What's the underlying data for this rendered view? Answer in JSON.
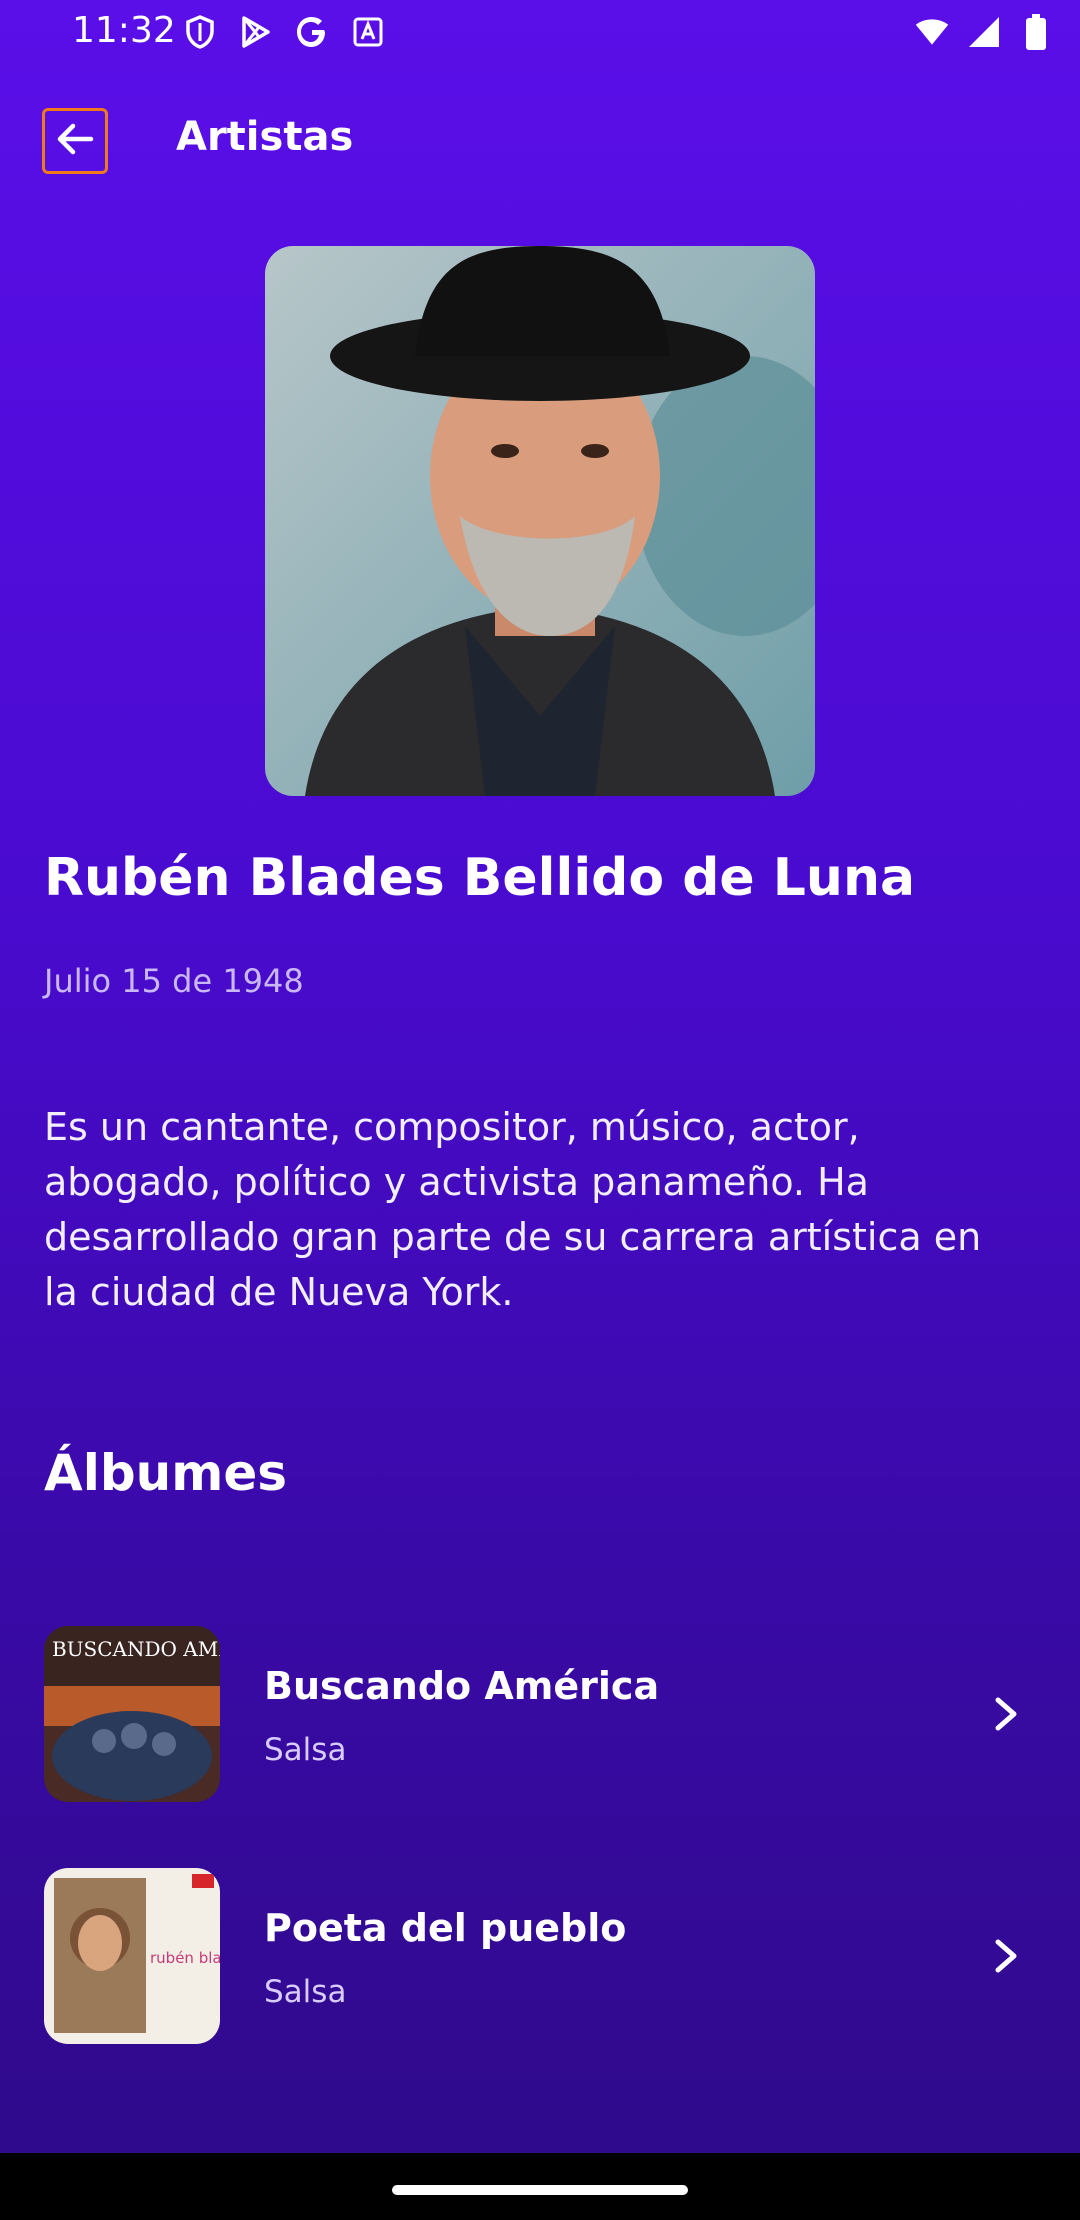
{
  "status_bar": {
    "time": "11:32",
    "left_icons": [
      "shield-icon",
      "play-store-icon",
      "google-icon",
      "translate-icon"
    ],
    "right_icons": [
      "wifi-icon",
      "signal-icon",
      "battery-icon"
    ]
  },
  "app_bar": {
    "back_icon": "arrow-left-icon",
    "title": "Artistas"
  },
  "artist": {
    "photo_alt": "artist-photo",
    "name": "Rubén Blades Bellido de Luna",
    "birth_date": "Julio 15 de 1948",
    "description": "Es un cantante, compositor, músico, actor, abogado, político y activista panameño. Ha desarrollado gran parte de su carrera artística en la ciudad de Nueva York."
  },
  "albums": {
    "heading": "Álbumes",
    "items": [
      {
        "title": "Buscando América",
        "genre": "Salsa",
        "cover_text": "BUSCANDO AMÉRICA"
      },
      {
        "title": "Poeta del pueblo",
        "genre": "Salsa",
        "cover_text": "rubén blades poeta del pueblo"
      }
    ]
  },
  "colors": {
    "accent_focus": "#f07a1a",
    "background_top": "#5a0ee8",
    "background_bottom": "#2e0a88"
  }
}
